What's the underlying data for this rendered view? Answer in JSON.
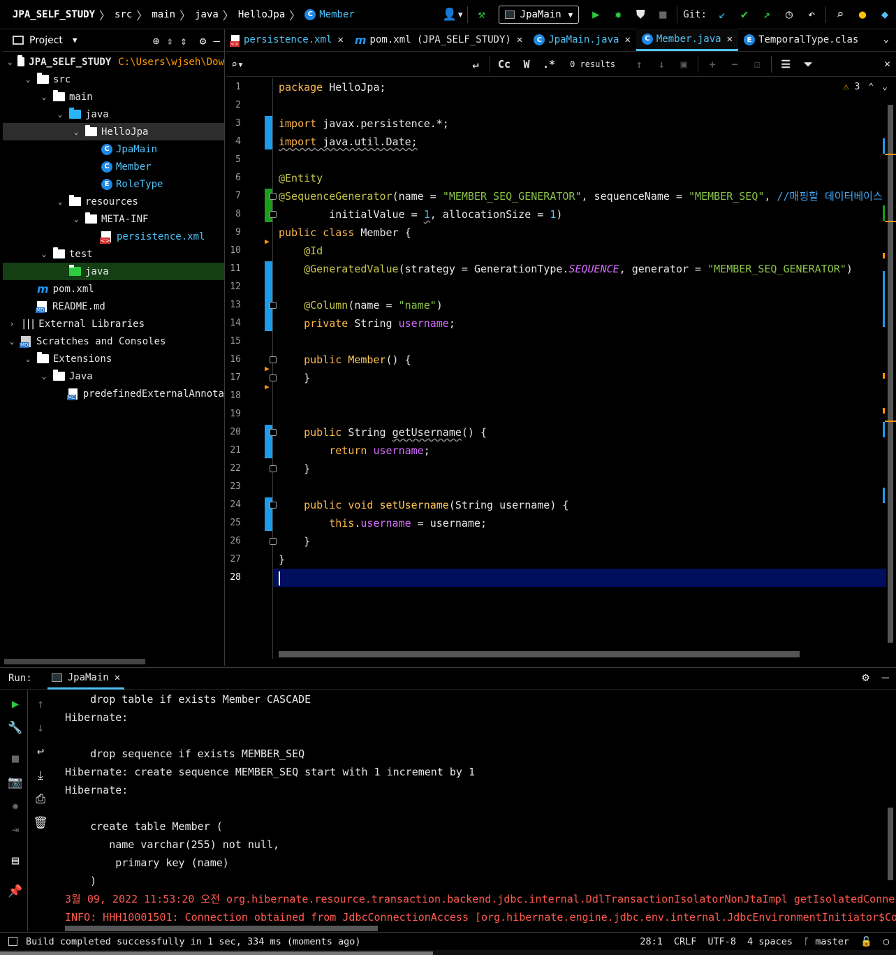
{
  "breadcrumb": [
    "JPA_SELF_STUDY",
    "src",
    "main",
    "java",
    "HelloJpa",
    "Member"
  ],
  "toolbar": {
    "run_config": "JpaMain",
    "git_label": "Git:"
  },
  "project_panel": {
    "title": "Project",
    "tree": [
      {
        "label": "JPA_SELF_STUDY",
        "hint": "C:\\Users\\wjseh\\Dow",
        "indent": 0,
        "arrow": "down",
        "icon": "folder",
        "bold": true
      },
      {
        "label": "src",
        "indent": 1,
        "arrow": "down",
        "icon": "folder"
      },
      {
        "label": "main",
        "indent": 2,
        "arrow": "down",
        "icon": "folder"
      },
      {
        "label": "java",
        "indent": 3,
        "arrow": "down",
        "icon": "folder-blue"
      },
      {
        "label": "HelloJpa",
        "indent": 4,
        "arrow": "down",
        "icon": "package",
        "selected": true
      },
      {
        "label": "JpaMain",
        "indent": 5,
        "arrow": "",
        "icon": "class",
        "blue": true
      },
      {
        "label": "Member",
        "indent": 5,
        "arrow": "",
        "icon": "class",
        "blue": true
      },
      {
        "label": "RoleType",
        "indent": 5,
        "arrow": "",
        "icon": "enum",
        "blue": true
      },
      {
        "label": "resources",
        "indent": 3,
        "arrow": "down",
        "icon": "folder"
      },
      {
        "label": "META-INF",
        "indent": 4,
        "arrow": "down",
        "icon": "folder"
      },
      {
        "label": "persistence.xml",
        "indent": 5,
        "arrow": "",
        "icon": "xml",
        "blue": true
      },
      {
        "label": "test",
        "indent": 2,
        "arrow": "down",
        "icon": "folder"
      },
      {
        "label": "java",
        "indent": 3,
        "arrow": "",
        "icon": "folder-green",
        "highlight": true
      },
      {
        "label": "pom.xml",
        "indent": 1,
        "arrow": "",
        "icon": "maven"
      },
      {
        "label": "README.md",
        "indent": 1,
        "arrow": "",
        "icon": "md"
      },
      {
        "label": "External Libraries",
        "indent": 0,
        "arrow": "right",
        "icon": "lib"
      },
      {
        "label": "Scratches and Consoles",
        "indent": 0,
        "arrow": "down",
        "icon": "scratch"
      },
      {
        "label": "Extensions",
        "indent": 1,
        "arrow": "down",
        "icon": "folder"
      },
      {
        "label": "Java",
        "indent": 2,
        "arrow": "down",
        "icon": "folder"
      },
      {
        "label": "predefinedExternalAnnota",
        "indent": 3,
        "arrow": "",
        "icon": "file"
      }
    ]
  },
  "tabs": [
    {
      "label": "persistence.xml",
      "icon": "xml",
      "active": false,
      "color": "blue"
    },
    {
      "label": "pom.xml (JPA_SELF_STUDY)",
      "icon": "maven",
      "active": false,
      "color": "white"
    },
    {
      "label": "JpaMain.java",
      "icon": "class",
      "active": false,
      "color": "blue"
    },
    {
      "label": "Member.java",
      "icon": "class",
      "active": true,
      "color": "blue"
    },
    {
      "label": "TemporalType.clas",
      "icon": "enum",
      "active": false,
      "color": "white"
    }
  ],
  "find": {
    "value": "",
    "results": "0 results",
    "match_case": "Cc",
    "words": "W",
    "regex": ".*"
  },
  "editor": {
    "warnings_count": "3",
    "current_line": 28,
    "line_count": 28
  },
  "run": {
    "label": "Run:",
    "tab": "JpaMain",
    "console": [
      {
        "text": "    drop table if exists Member CASCADE",
        "red": false
      },
      {
        "text": "Hibernate: ",
        "red": false
      },
      {
        "text": "",
        "red": false
      },
      {
        "text": "    drop sequence if exists MEMBER_SEQ",
        "red": false
      },
      {
        "text": "Hibernate: create sequence MEMBER_SEQ start with 1 increment by 1",
        "red": false
      },
      {
        "text": "Hibernate: ",
        "red": false
      },
      {
        "text": "",
        "red": false
      },
      {
        "text": "    create table Member (",
        "red": false
      },
      {
        "text": "       name varchar(255) not null,",
        "red": false
      },
      {
        "text": "        primary key (name)",
        "red": false
      },
      {
        "text": "    )",
        "red": false
      },
      {
        "text": "3월 09, 2022 11:53:20 오전 org.hibernate.resource.transaction.backend.jdbc.internal.DdlTransactionIsolatorNonJtaImpl getIsolatedConne",
        "red": true
      },
      {
        "text": "INFO: HHH10001501: Connection obtained from JdbcConnectionAccess [org.hibernate.engine.jdbc.env.internal.JdbcEnvironmentInitiator$Co",
        "red": true
      }
    ]
  },
  "status": {
    "message": "Build completed successfully in 1 sec, 334 ms (moments ago)",
    "position": "28:1",
    "line_sep": "CRLF",
    "encoding": "UTF-8",
    "indent": "4 spaces",
    "branch": "master"
  },
  "colors": {
    "accent": "#4fc3f7",
    "vcs_modified": "#1e9bea",
    "vcs_added": "#1b9e1b",
    "error_text": "#ff5a4f",
    "current_line_bg": "#000e5e"
  }
}
